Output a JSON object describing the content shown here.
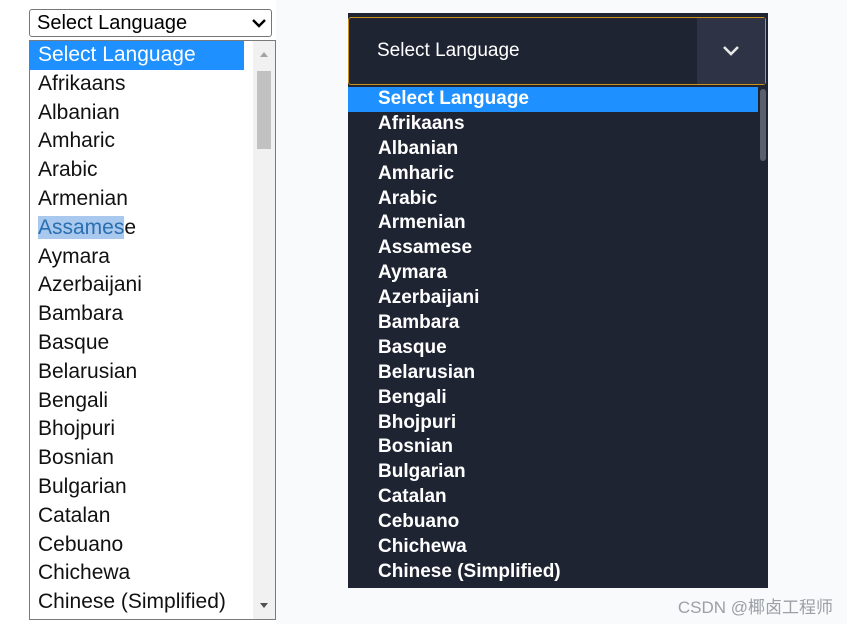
{
  "left": {
    "select_value": "Select Language",
    "options": [
      "Select Language",
      "Afrikaans",
      "Albanian",
      "Amharic",
      "Arabic",
      "Armenian",
      "Assamese",
      "Aymara",
      "Azerbaijani",
      "Bambara",
      "Basque",
      "Belarusian",
      "Bengali",
      "Bhojpuri",
      "Bosnian",
      "Bulgarian",
      "Catalan",
      "Cebuano",
      "Chichewa",
      "Chinese (Simplified)"
    ],
    "assamese_parts": [
      "Assames",
      "e"
    ]
  },
  "right": {
    "select_value": "Select Language",
    "options": [
      "Select Language",
      "Afrikaans",
      "Albanian",
      "Amharic",
      "Arabic",
      "Armenian",
      "Assamese",
      "Aymara",
      "Azerbaijani",
      "Bambara",
      "Basque",
      "Belarusian",
      "Bengali",
      "Bhojpuri",
      "Bosnian",
      "Bulgarian",
      "Catalan",
      "Cebuano",
      "Chichewa",
      "Chinese (Simplified)"
    ]
  },
  "watermark": "CSDN @椰卤工程师",
  "colors": {
    "selected": "#1e90ff",
    "dark_bg": "#1f2433",
    "border_accent": "#c8921d"
  }
}
